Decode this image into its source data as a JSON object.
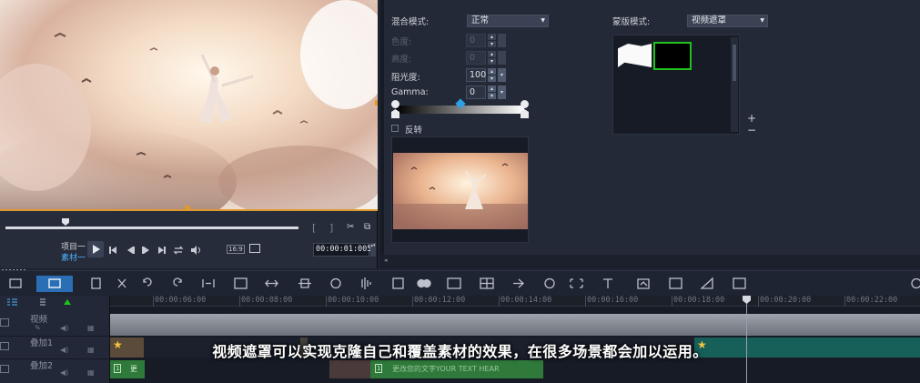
{
  "preview": {
    "controls": {
      "project_label": "项目一",
      "clip_label": "素材一",
      "bracket_left": "[",
      "bracket_right": "]",
      "ratio_label": "16:9",
      "timecode": "00:00:01:005"
    }
  },
  "mask_options": {
    "blend_mode_label": "混合模式:",
    "blend_mode_value": "正常",
    "hue_label": "色度:",
    "hue_value": "0",
    "lum_label": "高度:",
    "lum_value": "0",
    "opacity_label": "阻光度:",
    "opacity_value": "100",
    "gamma_label": "Gamma:",
    "gamma_value": "0",
    "invert_label": "反转",
    "mask_mode_label": "蒙版模式:",
    "mask_mode_value": "视频遮罩",
    "add_label": "+",
    "remove_label": "−"
  },
  "timeline": {
    "ticks": [
      "00:00:06:00",
      "00:00:08:00",
      "00:00:10:00",
      "00:00:12:00",
      "00:00:14:00",
      "00:00:16:00",
      "00:00:18:00",
      "00:00:20:00",
      "00:00:22:00"
    ],
    "tracks": [
      {
        "name": "视频"
      },
      {
        "name": "叠加1"
      },
      {
        "name": "叠加2"
      }
    ],
    "title_clip_text": "更改您的文字YOUR TEXT HEAR",
    "title_clip_short": "更",
    "title_clip_num": "1"
  },
  "caption": "视频遮罩可以实现克隆自己和覆盖素材的效果，在很多场景都会加以运用。",
  "colors": {
    "accent": "#e09a2c",
    "mask_select": "#21c21b",
    "title_track": "#2f7a3a",
    "overlay_clip": "#17605a"
  }
}
